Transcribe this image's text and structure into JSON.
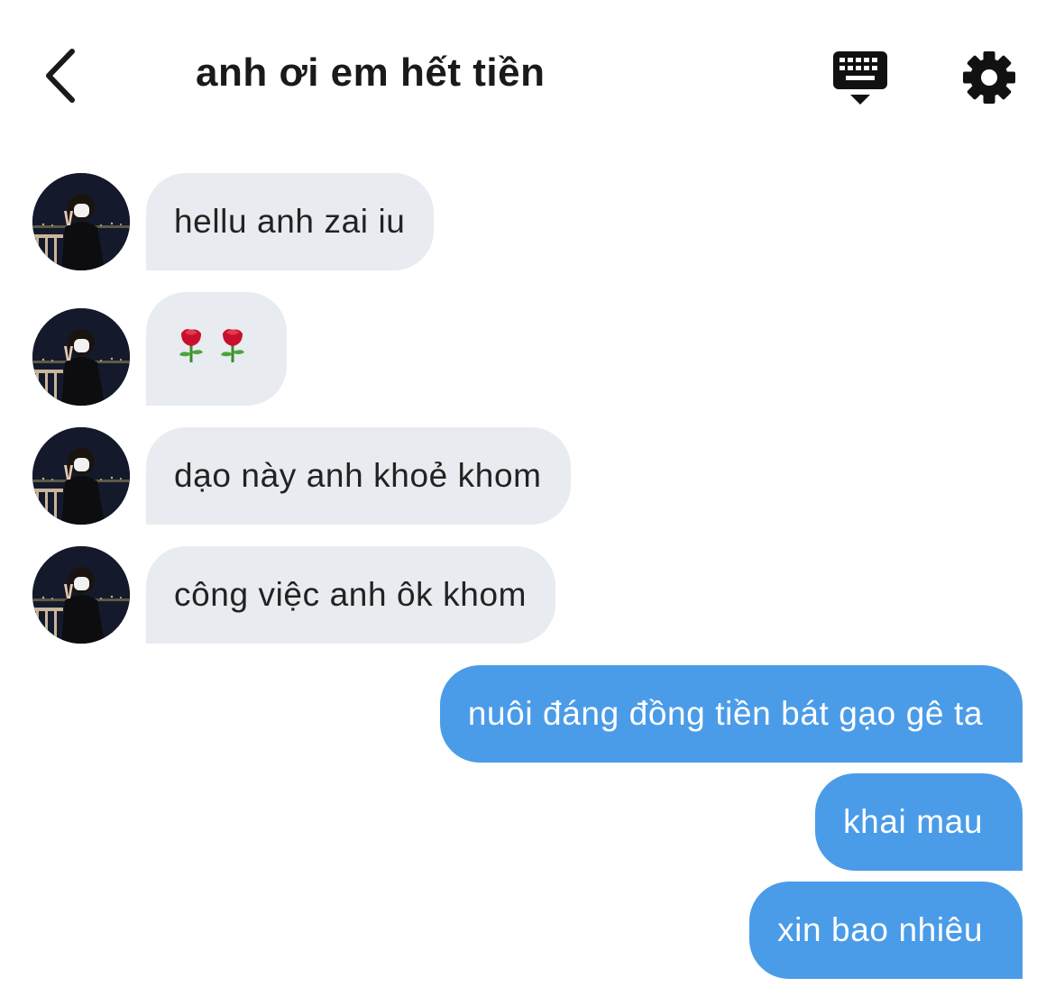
{
  "header": {
    "title": "anh ơi em hết tiền",
    "back_icon": "chevron-left-icon",
    "keyboard_icon": "keyboard-icon",
    "settings_icon": "gear-icon"
  },
  "colors": {
    "incoming_bubble": "#e8ebef",
    "outgoing_bubble": "#4b9ce8",
    "text": "#1a1a1a"
  },
  "messages": [
    {
      "direction": "incoming",
      "text": "hellu anh zai iu"
    },
    {
      "direction": "incoming",
      "text": "🌹🌹",
      "emoji": [
        "rose",
        "rose"
      ]
    },
    {
      "direction": "incoming",
      "text": "dạo này anh khoẻ khom"
    },
    {
      "direction": "incoming",
      "text": "công việc anh ôk khom"
    },
    {
      "direction": "outgoing",
      "text": "nuôi đáng đồng tiền bát gạo gê ta"
    },
    {
      "direction": "outgoing",
      "text": "khai mau"
    },
    {
      "direction": "outgoing",
      "text": "xin bao nhiêu"
    }
  ]
}
